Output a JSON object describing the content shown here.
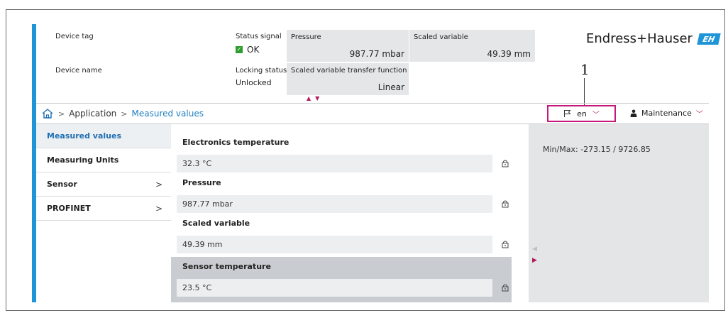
{
  "header": {
    "device_tag_label": "Device tag",
    "device_name_label": "Device name",
    "status_signal_label": "Status signal",
    "status_signal_value": "OK",
    "locking_status_label": "Locking status",
    "locking_status_value": "Unlocked",
    "tiles": [
      {
        "label": "Pressure",
        "value": "987.77 mbar"
      },
      {
        "label": "Scaled variable",
        "value": "49.39 mm"
      },
      {
        "label": "Scaled variable transfer function",
        "value": "Linear"
      }
    ],
    "brand": "Endress+Hauser",
    "brand_logo_text": "EH",
    "callout_number": "1"
  },
  "breadcrumb": {
    "items": [
      "Application",
      "Measured values"
    ]
  },
  "toolbar": {
    "language": "en",
    "role": "Maintenance"
  },
  "sidebar": {
    "items": [
      {
        "label": "Measured values",
        "active": true
      },
      {
        "label": "Measuring Units"
      },
      {
        "label": "Sensor",
        "submenu": ">"
      },
      {
        "label": "PROFINET",
        "submenu": ">"
      }
    ]
  },
  "main": {
    "groups": [
      {
        "title": "Electronics temperature",
        "value": "32.3 °C"
      },
      {
        "title": "Pressure",
        "value": "987.77 mbar"
      },
      {
        "title": "Scaled variable",
        "value": "49.39 mm"
      },
      {
        "title": "Sensor temperature",
        "value": "23.5 °C"
      }
    ]
  },
  "info_panel": {
    "minmax": "Min/Max: -273.15 / 9726.85"
  },
  "colors": {
    "accent_blue": "#1f95d8",
    "highlight_magenta": "#c6187a",
    "ok_green": "#2f9d2f"
  }
}
